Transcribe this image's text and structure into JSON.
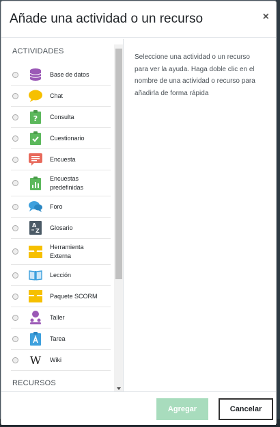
{
  "modal": {
    "title": "Añade una actividad o un recurso",
    "close_glyph": "×"
  },
  "activities_heading": "ACTIVIDADES",
  "resources_heading": "RECURSOS",
  "activities": [
    {
      "label": "Base de datos",
      "icon": "database-icon",
      "color": "#9b59b6"
    },
    {
      "label": "Chat",
      "icon": "chat-bubble-icon",
      "color": "#f6c000"
    },
    {
      "label": "Consulta",
      "icon": "poll-icon",
      "color": "#5cb85c"
    },
    {
      "label": "Cuestionario",
      "icon": "quiz-icon",
      "color": "#5cb85c"
    },
    {
      "label": "Encuesta",
      "icon": "survey-icon",
      "color": "#e86a5c"
    },
    {
      "label": "Encuestas predefinidas",
      "icon": "predefined-survey-icon",
      "color": "#5cb85c"
    },
    {
      "label": "Foro",
      "icon": "forum-icon",
      "color": "#3ea0dd"
    },
    {
      "label": "Glosario",
      "icon": "glossary-icon",
      "color": "#4b5a66"
    },
    {
      "label": "Herramienta Externa",
      "icon": "puzzle-icon",
      "color": "#f6c000"
    },
    {
      "label": "Lección",
      "icon": "lesson-book-icon",
      "color": "#3ea0dd"
    },
    {
      "label": "Paquete SCORM",
      "icon": "scorm-package-icon",
      "color": "#f6c000"
    },
    {
      "label": "Taller",
      "icon": "workshop-icon",
      "color": "#9b59b6"
    },
    {
      "label": "Tarea",
      "icon": "assignment-icon",
      "color": "#3ea0dd"
    },
    {
      "label": "Wiki",
      "icon": "wiki-icon",
      "color": "#222222"
    }
  ],
  "help_text": "Seleccione una actividad o un recurso para ver la ayuda. Haga doble clic en el nombre de una actividad o recurso para añadirla de forma rápida",
  "footer": {
    "add_label": "Agregar",
    "cancel_label": "Cancelar"
  }
}
